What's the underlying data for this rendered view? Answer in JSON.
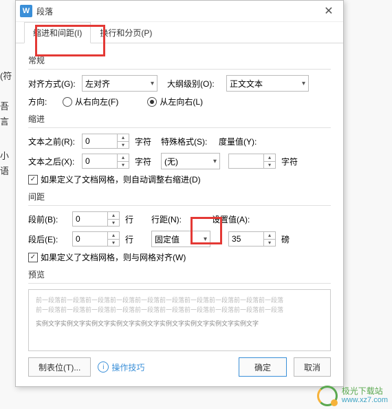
{
  "left_fragment_1": "(符",
  "left_fragment_2": "吾言",
  "left_fragment_3": "小语",
  "titlebar": {
    "app_glyph": "W",
    "title": "段落"
  },
  "tabs": {
    "indent": "缩进和间距(I)",
    "page": "换行和分页(P)"
  },
  "general": {
    "header": "常规",
    "align_label": "对齐方式(G):",
    "align_value": "左对齐",
    "outline_label": "大纲级别(O):",
    "outline_value": "正文文本",
    "direction_label": "方向:",
    "rtl_label": "从右向左(F)",
    "ltr_label": "从左向右(L)"
  },
  "indent": {
    "header": "缩进",
    "before_label": "文本之前(R):",
    "before_value": "0",
    "before_unit": "字符",
    "after_label": "文本之后(X):",
    "after_value": "0",
    "after_unit": "字符",
    "special_label": "特殊格式(S):",
    "special_value": "(无)",
    "measure_label": "度量值(Y):",
    "measure_value": "",
    "measure_unit": "字符",
    "grid_check": "如果定义了文档网格，则自动调整右缩进(D)"
  },
  "spacing": {
    "header": "间距",
    "before_label": "段前(B):",
    "before_value": "0",
    "before_unit": "行",
    "after_label": "段后(E):",
    "after_value": "0",
    "after_unit": "行",
    "line_label": "行距(N):",
    "line_value": "固定值",
    "set_label": "设置值(A):",
    "set_value": "35",
    "set_unit": "磅",
    "grid_check": "如果定义了文档网格，则与网格对齐(W)"
  },
  "preview": {
    "header": "预览",
    "grey": "前一段落前一段落前一段落前一段落前一段落前一段落前一段落前一段落前一段落前一段落",
    "sample": "实例文字实例文字实例文字实例文字实例文字实例文字实例文字实例文字实例文字"
  },
  "footer": {
    "tabstops": "制表位(T)...",
    "tips": "操作技巧",
    "ok": "确定",
    "cancel": "取消"
  },
  "watermark": {
    "name": "极光下载站",
    "site": "www.xz7.com"
  }
}
